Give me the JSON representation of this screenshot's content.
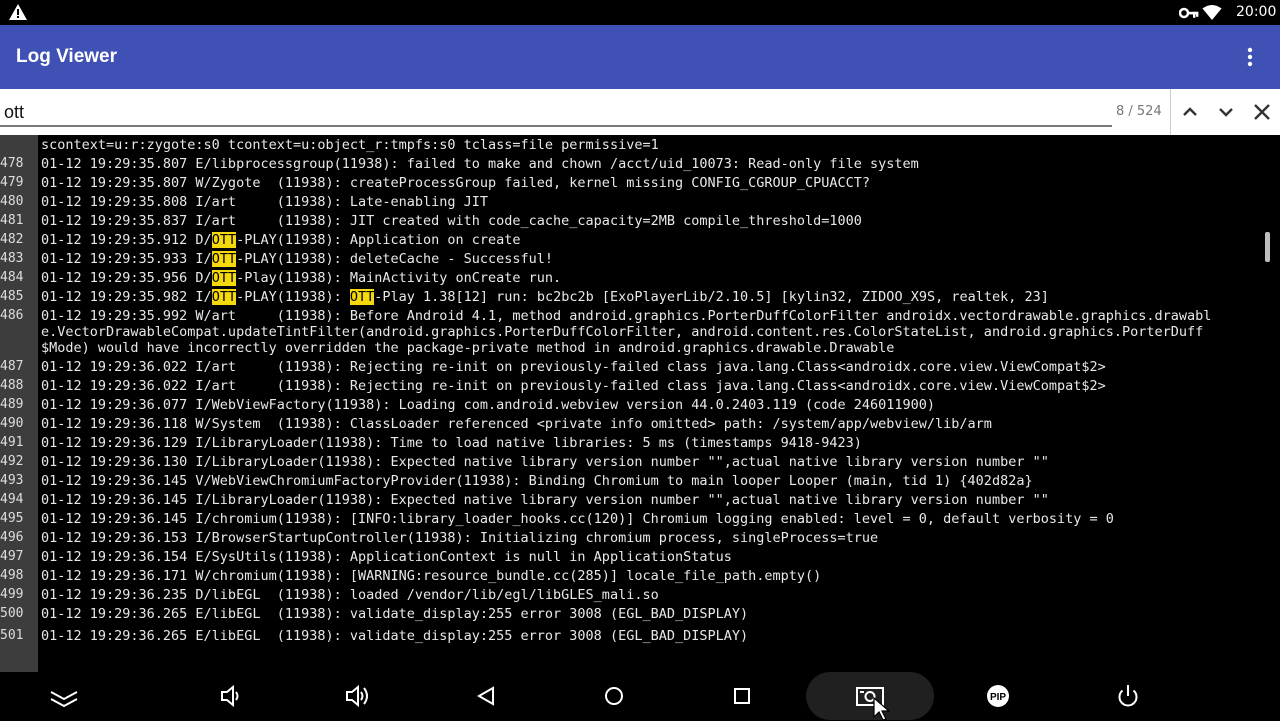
{
  "status_bar": {
    "time": "20:00",
    "icons": [
      "warning-icon",
      "vpn-key-icon",
      "wifi-icon"
    ]
  },
  "app_bar": {
    "title": "Log Viewer",
    "menu_icon": "more-vert-icon",
    "color": "#3f51b5"
  },
  "search": {
    "query": "ott",
    "match_count": "8 / 524",
    "highlight_color": "#f5d90a",
    "buttons": [
      "previous-match-icon",
      "next-match-icon",
      "close-icon"
    ]
  },
  "log": {
    "lines": [
      {
        "num": "",
        "segments": [
          {
            "t": "scontext=u:r:zygote:s0 tcontext=u:object_r:tmpfs:s0 tclass=file permissive=1"
          }
        ]
      },
      {
        "num": "478",
        "segments": [
          {
            "t": "01-12 19:29:35.807 E/libprocessgroup(11938): failed to make and chown /acct/uid_10073: Read-only file system"
          }
        ]
      },
      {
        "num": "479",
        "segments": [
          {
            "t": "01-12 19:29:35.807 W/Zygote  (11938): createProcessGroup failed, kernel missing CONFIG_CGROUP_CPUACCT?"
          }
        ]
      },
      {
        "num": "480",
        "segments": [
          {
            "t": "01-12 19:29:35.808 I/art     (11938): Late-enabling JIT"
          }
        ]
      },
      {
        "num": "481",
        "segments": [
          {
            "t": "01-12 19:29:35.837 I/art     (11938): JIT created with code_cache_capacity=2MB compile_threshold=1000"
          }
        ]
      },
      {
        "num": "482",
        "segments": [
          {
            "t": "01-12 19:29:35.912 D/"
          },
          {
            "t": "OTT",
            "h": true
          },
          {
            "t": "-PLAY(11938): Application on create"
          }
        ]
      },
      {
        "num": "483",
        "segments": [
          {
            "t": "01-12 19:29:35.933 I/"
          },
          {
            "t": "OTT",
            "h": true
          },
          {
            "t": "-PLAY(11938): deleteCache - Successful!"
          }
        ]
      },
      {
        "num": "484",
        "segments": [
          {
            "t": "01-12 19:29:35.956 D/"
          },
          {
            "t": "OTT",
            "h": true
          },
          {
            "t": "-Play(11938): MainActivity onCreate run."
          }
        ]
      },
      {
        "num": "485",
        "segments": [
          {
            "t": "01-12 19:29:35.982 I/"
          },
          {
            "t": "OTT",
            "h": true
          },
          {
            "t": "-PLAY(11938): "
          },
          {
            "t": "OTT",
            "h": true
          },
          {
            "t": "-Play 1.38[12] run: bc2bc2b [ExoPlayerLib/2.10.5] [kylin32, ZIDOO_X9S, realtek, 23]"
          }
        ]
      },
      {
        "num": "486",
        "segments": [
          {
            "t": "01-12 19:29:35.992 W/art     (11938): Before Android 4.1, method android.graphics.PorterDuffColorFilter androidx.vectordrawable.graphics.drawable.VectorDrawableCompat.updateTintFilter(android.graphics.PorterDuffColorFilter, android.content.res.ColorStateList, android.graphics.PorterDuff$Mode) would have incorrectly overridden the package-private method in android.graphics.drawable.Drawable"
          }
        ]
      },
      {
        "num": "487",
        "segments": [
          {
            "t": "01-12 19:29:36.022 I/art     (11938): Rejecting re-init on previously-failed class java.lang.Class<androidx.core.view.ViewCompat$2>"
          }
        ]
      },
      {
        "num": "488",
        "segments": [
          {
            "t": "01-12 19:29:36.022 I/art     (11938): Rejecting re-init on previously-failed class java.lang.Class<androidx.core.view.ViewCompat$2>"
          }
        ]
      },
      {
        "num": "489",
        "segments": [
          {
            "t": "01-12 19:29:36.077 I/WebViewFactory(11938): Loading com.android.webview version 44.0.2403.119 (code 246011900)"
          }
        ]
      },
      {
        "num": "490",
        "segments": [
          {
            "t": "01-12 19:29:36.118 W/System  (11938): ClassLoader referenced <private info omitted> path: /system/app/webview/lib/arm"
          }
        ]
      },
      {
        "num": "491",
        "segments": [
          {
            "t": "01-12 19:29:36.129 I/LibraryLoader(11938): Time to load native libraries: 5 ms (timestamps 9418-9423)"
          }
        ]
      },
      {
        "num": "492",
        "segments": [
          {
            "t": "01-12 19:29:36.130 I/LibraryLoader(11938): Expected native library version number \"\",actual native library version number \"\""
          }
        ]
      },
      {
        "num": "493",
        "segments": [
          {
            "t": "01-12 19:29:36.145 V/WebViewChromiumFactoryProvider(11938): Binding Chromium to main looper Looper (main, tid 1) {402d82a}"
          }
        ]
      },
      {
        "num": "494",
        "segments": [
          {
            "t": "01-12 19:29:36.145 I/LibraryLoader(11938): Expected native library version number \"\",actual native library version number \"\""
          }
        ]
      },
      {
        "num": "495",
        "segments": [
          {
            "t": "01-12 19:29:36.145 I/chromium(11938): [INFO:library_loader_hooks.cc(120)] Chromium logging enabled: level = 0, default verbosity = 0"
          }
        ]
      },
      {
        "num": "496",
        "segments": [
          {
            "t": "01-12 19:29:36.153 I/BrowserStartupController(11938): Initializing chromium process, singleProcess=true"
          }
        ]
      },
      {
        "num": "497",
        "segments": [
          {
            "t": "01-12 19:29:36.154 E/SysUtils(11938): ApplicationContext is null in ApplicationStatus"
          }
        ]
      },
      {
        "num": "498",
        "segments": [
          {
            "t": "01-12 19:29:36.171 W/chromium(11938): [WARNING:resource_bundle.cc(285)] locale_file_path.empty()"
          }
        ]
      },
      {
        "num": "499",
        "segments": [
          {
            "t": "01-12 19:29:36.235 D/libEGL  (11938): loaded /vendor/lib/egl/libGLES_mali.so"
          }
        ]
      },
      {
        "num": "500",
        "segments": [
          {
            "t": "01-12 19:29:36.265 E/libEGL  (11938): validate_display:255 error 3008 (EGL_BAD_DISPLAY)"
          }
        ]
      },
      {
        "num": "",
        "segments": [
          {
            "t": ""
          }
        ]
      },
      {
        "num": "501",
        "segments": [
          {
            "t": "01-12 19:29:36.265 E/libEGL  (11938): validate_display:255 error 3008 (EGL_BAD_DISPLAY)"
          }
        ]
      }
    ]
  },
  "nav_bar": {
    "buttons": [
      "collapse-icon",
      "volume-down-icon",
      "volume-up-icon",
      "back-icon",
      "home-icon",
      "recents-icon",
      "screenshot-icon",
      "pip-icon",
      "power-icon"
    ],
    "pip_label": "PIP"
  }
}
